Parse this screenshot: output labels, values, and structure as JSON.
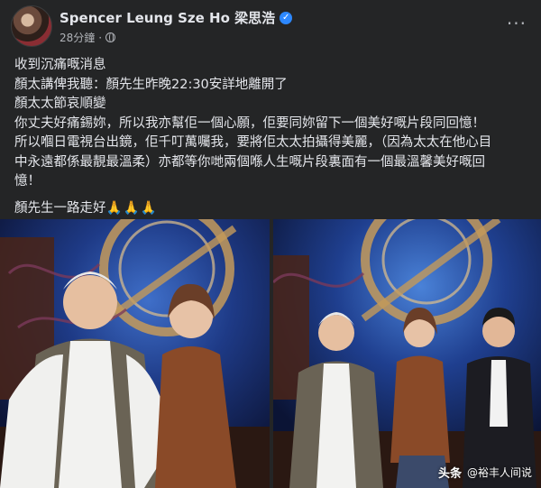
{
  "post": {
    "author": "Spencer Leung Sze Ho 梁思浩",
    "verified_icon": "verified-badge-icon",
    "time": "28分鐘",
    "privacy_icon": "globe-icon",
    "more_label": "···",
    "lines": [
      "收到沉痛嘅消息",
      "顏太講俾我聽：顏先生昨晚22:30安詳地離開了",
      "顏太太節哀順變",
      "你丈夫好痛錫妳，所以我亦幫佢一個心願，佢要同妳留下一個美好嘅片段同回憶！",
      "所以嗰日電視台出鏡，佢千叮萬囑我，要將佢太太拍攝得美麗，（因為太太在他心目",
      "中永遠都係最靚最溫柔）亦都等你哋兩個喺人生嘅片段裏面有一個最溫馨美好嘅回",
      "憶！"
    ],
    "closing": "顏先生一路走好",
    "closing_emoji": "🙏🙏🙏"
  },
  "watermark": {
    "logo": "头条",
    "handle": "@裕丰人间说"
  },
  "colors": {
    "background": "#242526",
    "text": "#e4e6eb",
    "secondary": "#b0b3b8",
    "verified": "#2d88ff"
  }
}
